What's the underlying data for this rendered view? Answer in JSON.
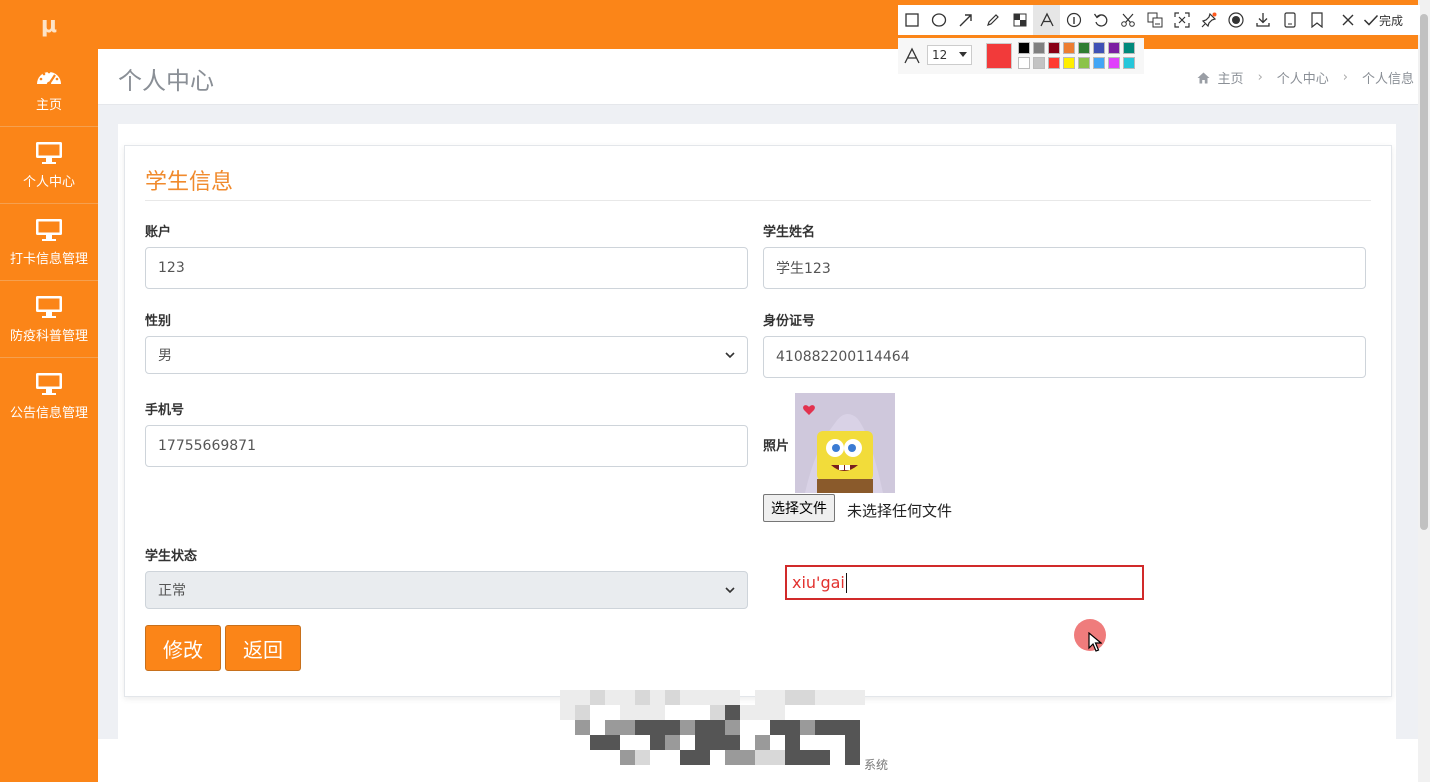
{
  "sidebar": {
    "logo": "μ",
    "items": [
      {
        "label": "主页",
        "icon": "dashboard-icon"
      },
      {
        "label": "个人中心",
        "icon": "monitor-icon"
      },
      {
        "label": "打卡信息管理",
        "icon": "monitor-icon"
      },
      {
        "label": "防疫科普管理",
        "icon": "monitor-icon"
      },
      {
        "label": "公告信息管理",
        "icon": "monitor-icon"
      }
    ]
  },
  "header": {
    "title": "个人中心",
    "breadcrumb": [
      "主页",
      "个人中心",
      "个人信息"
    ]
  },
  "form": {
    "title": "学生信息",
    "account_label": "账户",
    "account_value": "123",
    "name_label": "学生姓名",
    "name_value": "学生123",
    "gender_label": "性别",
    "gender_value": "男",
    "idcard_label": "身份证号",
    "idcard_value": "410882200114464",
    "phone_label": "手机号",
    "phone_value": "17755669871",
    "photo_label": "照片",
    "file_button": "选择文件",
    "file_status": "未选择任何文件",
    "status_label": "学生状态",
    "status_value": "正常",
    "submit_label": "修改",
    "back_label": "返回"
  },
  "annotation": {
    "text": "xiu'gai"
  },
  "footer": {
    "suffix": "系统"
  },
  "screenshot_tool": {
    "done_label": "完成",
    "font_size": "12",
    "current_color": "#f23a3a",
    "palette": [
      "#000000",
      "#7f7f7f",
      "#880015",
      "#ed7d31",
      "#2e7d32",
      "#3f51b5",
      "#7b1fa2",
      "#00897b",
      "#ffffff",
      "#c3c3c3",
      "#ff3b30",
      "#ffee00",
      "#8bc34a",
      "#42a5f5",
      "#e040fb",
      "#26c6da"
    ]
  },
  "colors": {
    "brand_orange": "#fb8518",
    "title_orange": "#f08a2c",
    "annotation_red": "#d12a2a"
  }
}
